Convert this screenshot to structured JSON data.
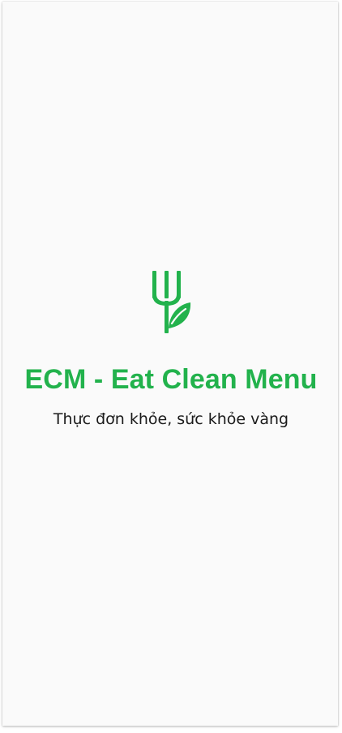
{
  "splash": {
    "logo_icon": "fork-leaf-icon",
    "title": "ECM - Eat Clean Menu",
    "subtitle": "Thực đơn khỏe, sức khỏe vàng"
  },
  "colors": {
    "brand_green": "#22b24c",
    "background": "#fafafa",
    "text": "#1a1a1a"
  }
}
